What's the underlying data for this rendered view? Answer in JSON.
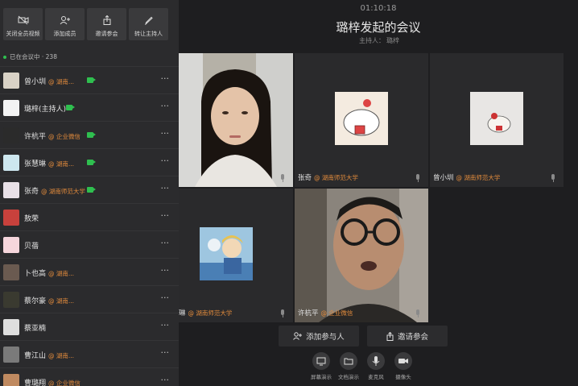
{
  "meeting": {
    "time": "01:10:18",
    "title": "璐梓发起的会议",
    "host_label": "主持人：",
    "host_name": "璐梓"
  },
  "sidebar": {
    "actions": [
      {
        "label": "关闭全员视频",
        "icon": "video-off-icon"
      },
      {
        "label": "添加成员",
        "icon": "add-user-icon"
      },
      {
        "label": "邀请参会",
        "icon": "share-icon"
      },
      {
        "label": "转让主持人",
        "icon": "pen-icon"
      }
    ],
    "status": "已在会议中 · 238",
    "participants": [
      {
        "name": "曾小圳",
        "org": "@ 湖南...",
        "camera": true
      },
      {
        "name": "璐梓(主持人)",
        "org": "",
        "camera": true
      },
      {
        "name": "许杭平",
        "org": "@ 企业微信",
        "camera": true
      },
      {
        "name": "张慧琳",
        "org": "@ 湖南...",
        "camera": true
      },
      {
        "name": "张奇",
        "org": "@ 湖南师范大学",
        "camera": true
      },
      {
        "name": "敖荣",
        "org": "",
        "camera": false
      },
      {
        "name": "贝蓓",
        "org": "",
        "camera": false
      },
      {
        "name": "卜也高",
        "org": "@ 湖南...",
        "camera": false
      },
      {
        "name": "蔡尔豪",
        "org": "@ 湖南...",
        "camera": false
      },
      {
        "name": "蔡亚楠",
        "org": "",
        "camera": false
      },
      {
        "name": "曹江山",
        "org": "@ 湖南...",
        "camera": false
      },
      {
        "name": "曹璐翔",
        "org": "@ 企业微信",
        "camera": false
      }
    ],
    "more_glyph": "···"
  },
  "tiles": [
    {
      "name": "",
      "org": ""
    },
    {
      "name": "张奇",
      "org": "@ 湖南师范大学"
    },
    {
      "name": "曾小圳",
      "org": "@ 湖南师范大学"
    },
    {
      "name": "琳",
      "org": "@ 湖南师范大学"
    },
    {
      "name": "许杭平",
      "org": "@ 企业微信"
    }
  ],
  "toolbar": {
    "add_participant": "添加参与人",
    "invite": "邀请参会"
  },
  "controls": [
    {
      "label": "屏幕演示",
      "icon": "screen-share-icon"
    },
    {
      "label": "文档演示",
      "icon": "folder-icon"
    },
    {
      "label": "麦克风",
      "icon": "microphone-icon"
    },
    {
      "label": "摄像头",
      "icon": "camera-icon"
    }
  ],
  "colors": {
    "sidebar_bg": "#2b2b2d",
    "stage_bg": "#1e1e20",
    "status_green": "#2fbf4f",
    "org_orange": "#e08a3c"
  }
}
